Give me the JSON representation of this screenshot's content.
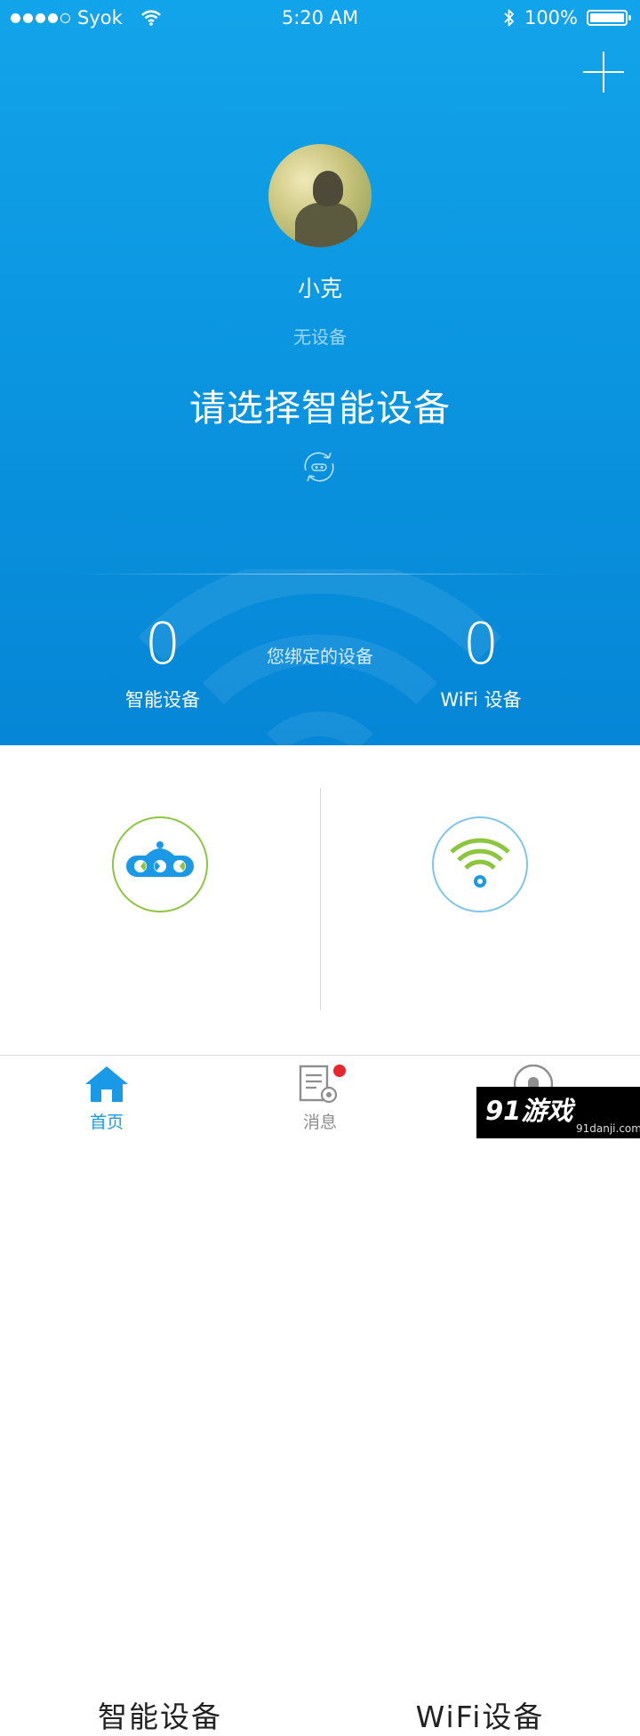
{
  "status": {
    "carrier": "Syok",
    "time": "5:20 AM",
    "battery": "100%",
    "signal_bars": 4
  },
  "profile": {
    "name": "小克",
    "device_status": "无设备"
  },
  "prompt": "请选择智能设备",
  "stats": {
    "center_label": "您绑定的设备",
    "left": {
      "count": "0",
      "label": "智能设备"
    },
    "right": {
      "count": "0",
      "label": "WiFi 设备"
    }
  },
  "cards": [
    {
      "label": "智能设备",
      "icon": "robot-icon",
      "ring_color": "#8cc63f"
    },
    {
      "label": "WiFi设备",
      "icon": "wifi-icon",
      "ring_color": "#7fc5e6"
    }
  ],
  "tabs": [
    {
      "label": "首页",
      "icon": "home-icon",
      "active": true
    },
    {
      "label": "消息",
      "icon": "message-settings-icon",
      "badge": true
    },
    {
      "label": "",
      "icon": "profile-icon"
    }
  ],
  "watermark": {
    "text": "91游戏",
    "url": "91danji.com"
  },
  "colors": {
    "accent": "#1a9ae6",
    "green": "#8cc63f",
    "badge": "#e8262e"
  }
}
